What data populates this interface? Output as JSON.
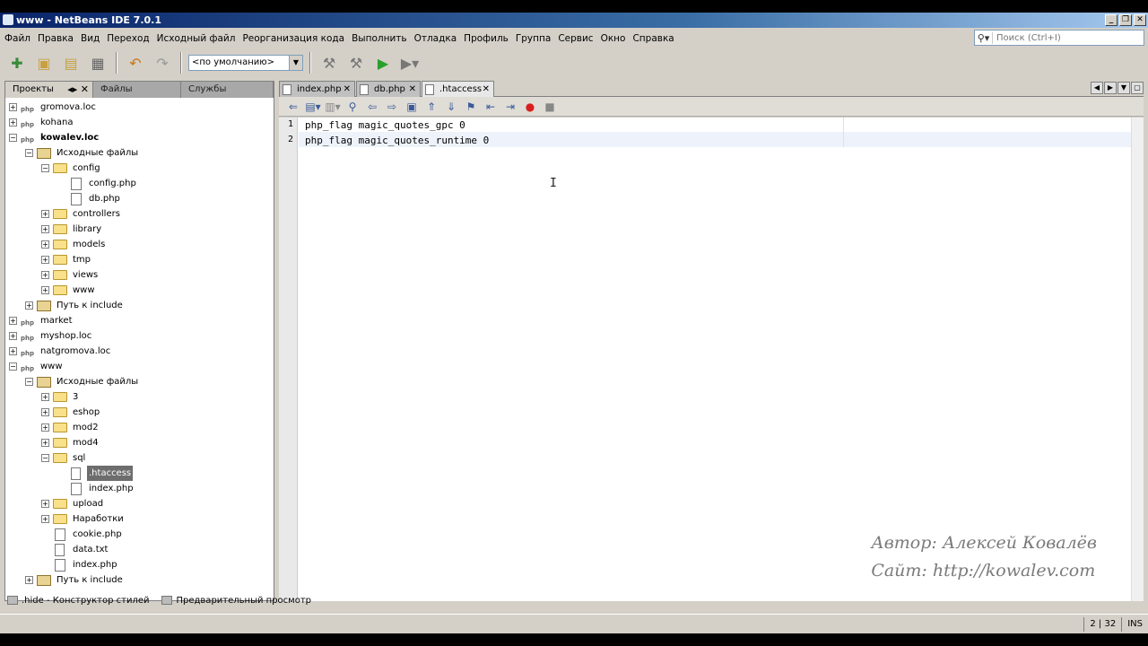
{
  "window": {
    "title": "www - NetBeans IDE 7.0.1"
  },
  "menu": [
    "Файл",
    "Правка",
    "Вид",
    "Переход",
    "Исходный файл",
    "Реорганизация кода",
    "Выполнить",
    "Отладка",
    "Профиль",
    "Группа",
    "Сервис",
    "Окно",
    "Справка"
  ],
  "search": {
    "placeholder": "Поиск (Ctrl+I)"
  },
  "toolbar": {
    "config_value": "<по умолчанию>"
  },
  "left_tabs": {
    "projects": "Проекты",
    "files": "Файлы",
    "services": "Службы"
  },
  "tree": {
    "gromova": "gromova.loc",
    "kohana": "kohana",
    "kowalev": "kowalev.loc",
    "src1": "Исходные файлы",
    "config": "config",
    "config_php": "config.php",
    "db_php": "db.php",
    "controllers": "controllers",
    "library": "library",
    "models": "models",
    "tmp": "tmp",
    "views": "views",
    "www_folder": "www",
    "include1": "Путь к include",
    "market": "market",
    "myshop": "myshop.loc",
    "natgromova": "natgromova.loc",
    "www_project": "www",
    "src2": "Исходные файлы",
    "f3": "3",
    "eshop": "eshop",
    "mod2": "mod2",
    "mod4": "mod4",
    "sql": "sql",
    "htaccess": ".htaccess",
    "index_sql": "index.php",
    "upload": "upload",
    "narabotki": "Наработки",
    "cookie": "cookie.php",
    "data": "data.txt",
    "index_root": "index.php",
    "include2": "Путь к include"
  },
  "editor_tabs": [
    "index.php",
    "db.php",
    ".htaccess"
  ],
  "code": {
    "lines": [
      "php_flag magic_quotes_gpc 0",
      "php_flag magic_quotes_runtime 0"
    ],
    "line_numbers": [
      "1",
      "2"
    ]
  },
  "watermark": {
    "author": "Автор: Алексей Ковалёв",
    "site": "Сайт: http://kowalev.com"
  },
  "bottom_tabs": {
    "css": ".hide - Конструктор стилей",
    "preview": "Предварительный просмотр"
  },
  "status": {
    "position": "2 | 32",
    "mode": "INS"
  }
}
